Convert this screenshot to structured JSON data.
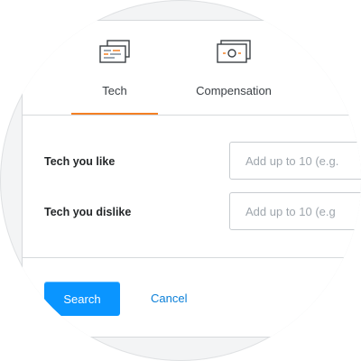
{
  "tabs": [
    {
      "label": "Tech",
      "icon": "tech-stack-icon",
      "active": true
    },
    {
      "label": "Compensation",
      "icon": "money-icon",
      "active": false
    },
    {
      "label": "",
      "icon": "next-tab-icon",
      "active": false
    }
  ],
  "form": {
    "tech_like": {
      "label": "Tech you like",
      "placeholder": "Add up to 10 (e.g."
    },
    "tech_dislike": {
      "label": "Tech you dislike",
      "placeholder": "Add up to 10 (e.g"
    }
  },
  "actions": {
    "search_label": "Search",
    "cancel_label": "Cancel"
  },
  "colors": {
    "accent_orange": "#f48024",
    "primary_blue": "#0a95ff",
    "link_blue": "#0a7fd8",
    "border_gray": "#d6d9dc"
  }
}
